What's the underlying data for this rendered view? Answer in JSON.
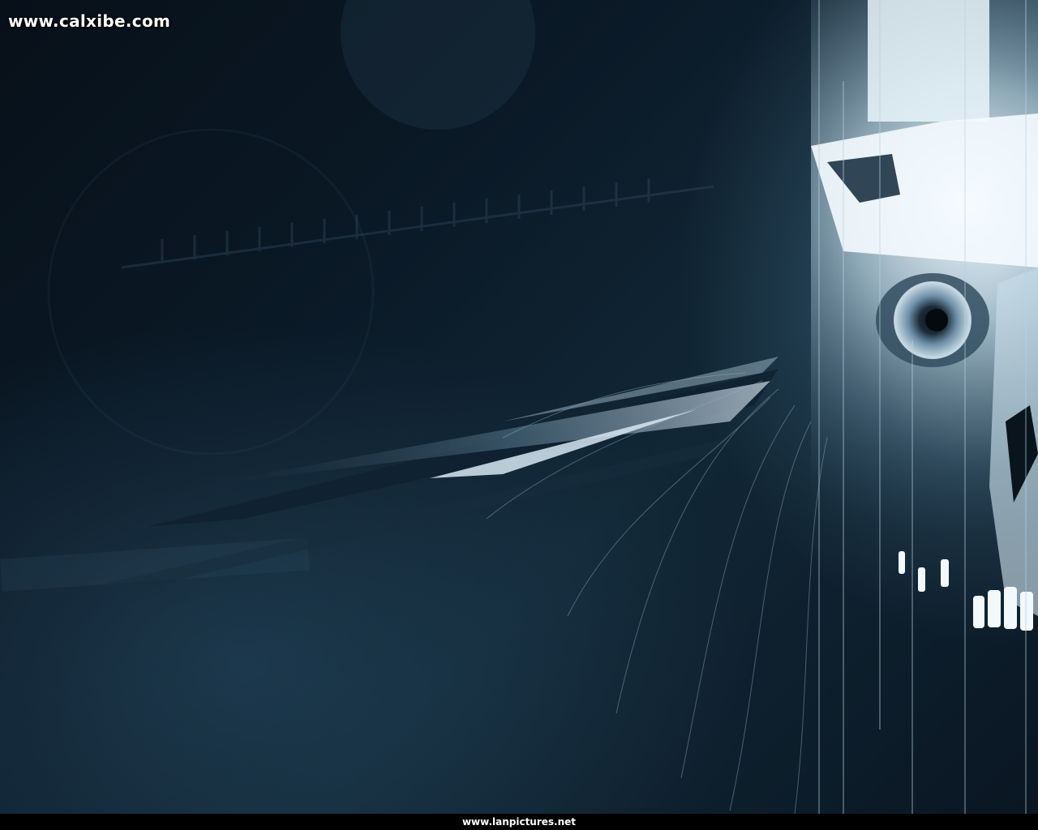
{
  "image": {
    "watermark_top": "www.calxibe.com",
    "watermark_bottom": "www.lanpictures.net",
    "palette": {
      "background_dark": "#050b12",
      "blue_mid": "#1d3a50",
      "highlight": "#e8f6ff",
      "footer_bar": "#000000"
    }
  }
}
